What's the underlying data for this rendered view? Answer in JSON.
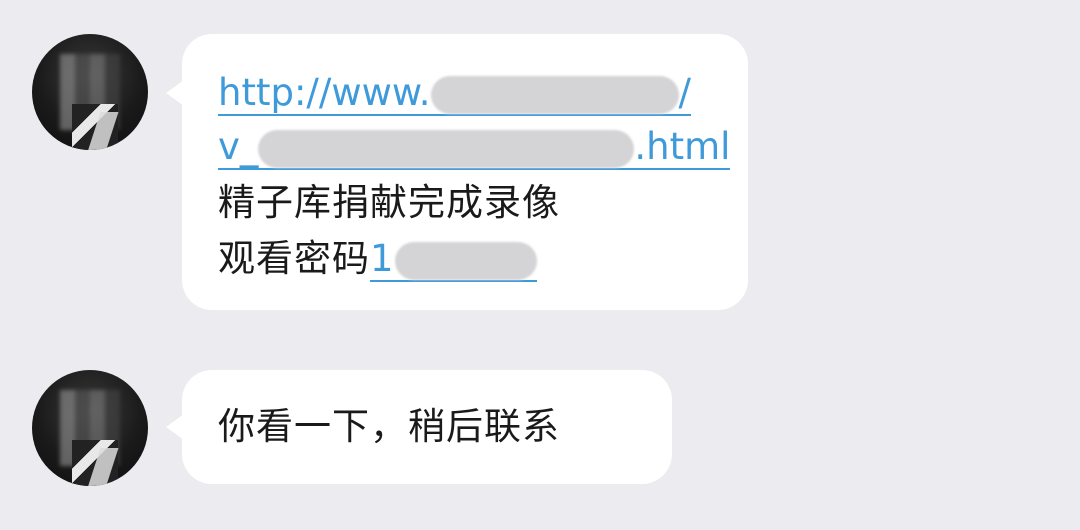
{
  "chat": {
    "messages": [
      {
        "link_line1_prefix": "http://www.",
        "link_line1_suffix": "/",
        "link_line2_prefix": "v_",
        "link_line2_suffix": ".html",
        "text_line1": "精子库捐献完成录像",
        "text_line2_prefix": "观看密码",
        "password_visible_digit": "1"
      },
      {
        "text": "你看一下，稍后联系"
      }
    ]
  }
}
